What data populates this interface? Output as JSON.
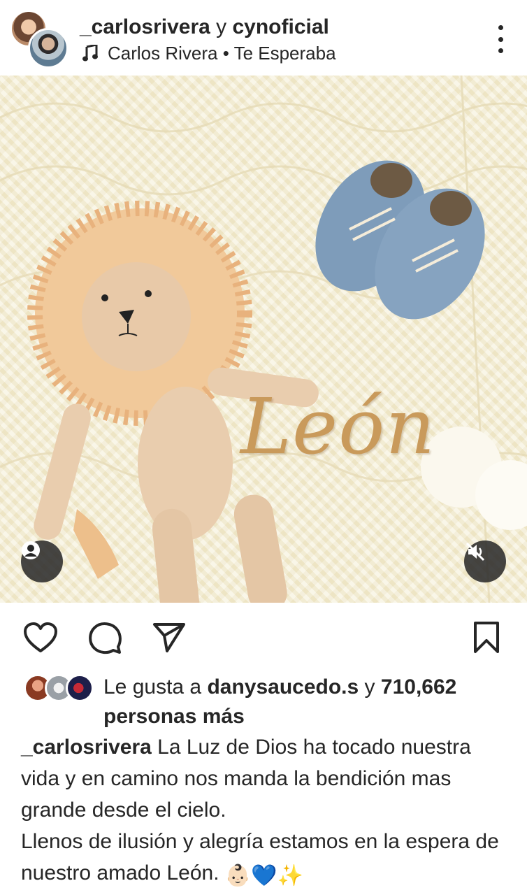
{
  "post": {
    "author_primary": "_carlosrivera",
    "joiner": " y ",
    "author_secondary": "cynoficial",
    "music": {
      "icon": "music-note-icon",
      "artist_track": "Carlos Rivera • Te Esperaba"
    },
    "more_icon": "more-options-icon"
  },
  "media": {
    "embroidered_text": "León",
    "tag_icon": "tagged-user-icon",
    "mute_icon": "volume-muted-icon"
  },
  "actions": {
    "like_icon": "heart-icon",
    "comment_icon": "comment-bubble-icon",
    "share_icon": "paper-plane-icon",
    "save_icon": "bookmark-icon"
  },
  "likes": {
    "prefix": "Le gusta a ",
    "user": "danysaucedo.s",
    "middle": " y ",
    "count": "710,662",
    "suffix": "personas más"
  },
  "caption": {
    "user": "_carlosrivera",
    "line1": " La Luz de Dios ha tocado nuestra vida y en camino nos manda la bendición mas grande desde el cielo.",
    "line2": "Llenos de ilusión y alegría estamos en la espera de nuestro amado León. ",
    "emojis": "👶🏻💙✨"
  },
  "colors": {
    "text": "#262626",
    "embroidery": "#c99a5b",
    "overlay_button": "#262626",
    "shoe_blue": "#7e9cba"
  }
}
